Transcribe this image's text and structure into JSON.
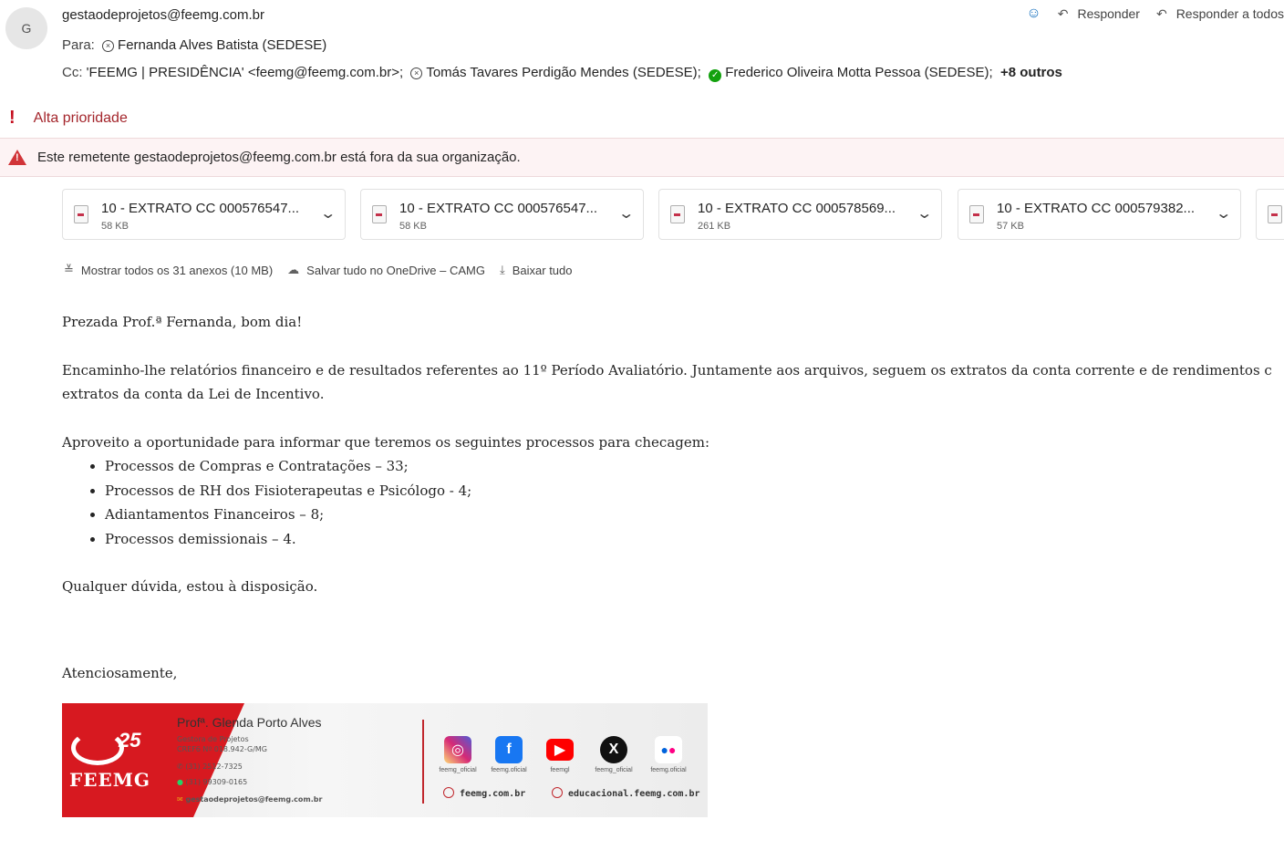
{
  "header": {
    "avatar_initial": "G",
    "sender": "gestaodeprojetos@feemg.com.br",
    "to_label": "Para:",
    "to_recipients": [
      "Fernanda Alves Batista (SEDESE)"
    ],
    "cc_label": "Cc:",
    "cc_recipients": [
      "'FEEMG | PRESIDÊNCIA' <feemg@feemg.com.br>;",
      "Tomás Tavares Perdigão Mendes (SEDESE);",
      "Frederico Oliveira Motta Pessoa (SEDESE);"
    ],
    "cc_more": "+8 outros",
    "reply_label": "Responder",
    "reply_all_label": "Responder a todos"
  },
  "priority": "Alta prioridade",
  "external_warning": "Este remetente gestaodeprojetos@feemg.com.br está fora da sua organização.",
  "attachments": [
    {
      "name": "10 - EXTRATO CC 000576547...",
      "size": "58 KB"
    },
    {
      "name": "10 - EXTRATO CC 000576547...",
      "size": "58 KB"
    },
    {
      "name": "10 - EXTRATO CC 000578569...",
      "size": "261 KB"
    },
    {
      "name": "10 - EXTRATO CC 000579382...",
      "size": "57 KB"
    }
  ],
  "attachment_actions": {
    "show_all": "Mostrar todos os 31 anexos (10 MB)",
    "save_onedrive": "Salvar tudo no OneDrive – CAMG",
    "download_all": "Baixar tudo"
  },
  "body": {
    "greeting": "Prezada Prof.ª Fernanda, bom dia!",
    "para1_line1": "Encaminho-lhe relatórios financeiro e de resultados referentes ao 11º Período Avaliatório. Juntamente aos arquivos, seguem os extratos da conta corrente e de rendimentos c",
    "para1_line2": "extratos da conta da Lei de Incentivo.",
    "para2": "Aproveito a oportunidade para informar que teremos os seguintes processos para checagem:",
    "items": [
      "Processos de Compras e Contratações – 33;",
      "Processos de RH dos Fisioterapeutas e Psicólogo  - 4;",
      "Adiantamentos Financeiros – 8;",
      "Processos demissionais – 4."
    ],
    "closing_question": "Qualquer dúvida, estou à disposição.",
    "signoff": "Atenciosamente,"
  },
  "signature": {
    "logo_text": "FEEMG",
    "anniversary": "25",
    "name": "Profª. Glenda Porto Alves",
    "role": "Gestora de Projetos",
    "cref": "CREF6 Nº 018.942-G/MG",
    "phone": "(31) 2512-7325",
    "whatsapp": "(31) 99309-0165",
    "email": "gestaodeprojetos@feemg.com.br",
    "social": [
      {
        "label": "feemg_oficial",
        "icon": "instagram-icon",
        "color": "#d62976"
      },
      {
        "label": "feemg.oficial",
        "icon": "facebook-icon",
        "color": "#1877f2"
      },
      {
        "label": "feemgl",
        "icon": "youtube-icon",
        "color": "#ff0000"
      },
      {
        "label": "feemg_oficial",
        "icon": "x-icon",
        "color": "#111111"
      },
      {
        "label": "feemg.oficial",
        "icon": "flickr-icon",
        "color": "#ffffff"
      }
    ],
    "site1": "feemg.com.br",
    "site2": "educacional.feemg.com.br"
  }
}
